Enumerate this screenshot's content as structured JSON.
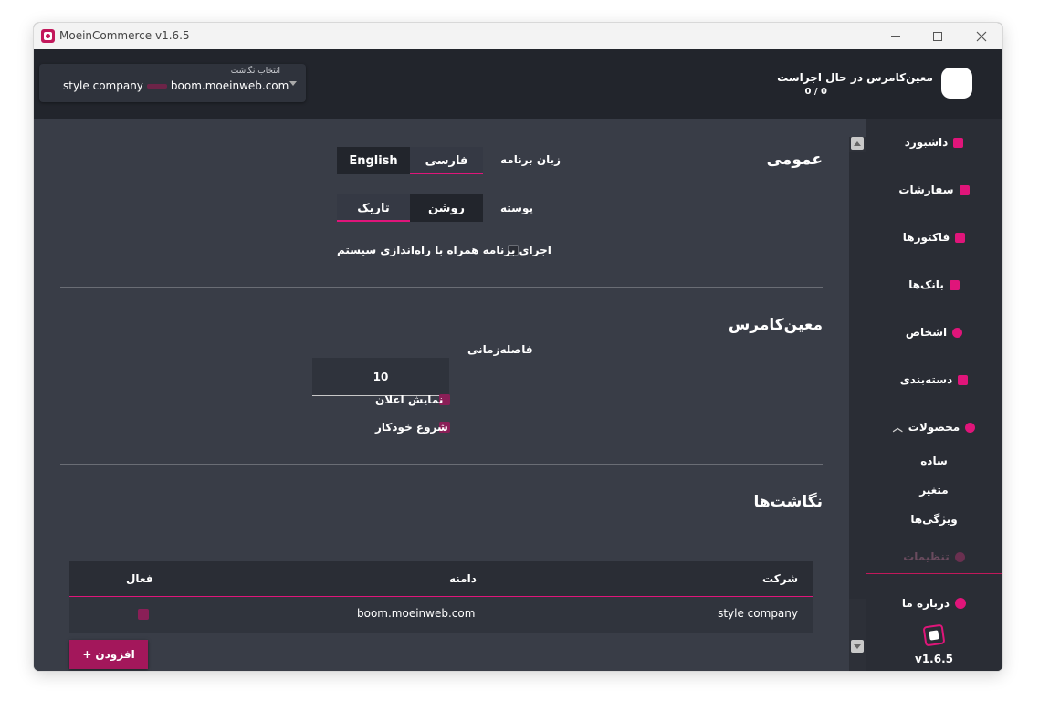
{
  "app": {
    "title": "MoeinCommerce v1.6.5",
    "version": "v1.6.5"
  },
  "header": {
    "blog_select_caption": "انتخاب نگاشت",
    "blog_company": "style company",
    "blog_domain": "boom.moeinweb.com",
    "status_title": "معین‌کامرس در حال اجراست",
    "status_count": "0 / 0"
  },
  "general": {
    "title": "عمومی",
    "language_label": "زبان برنامه",
    "language_options": [
      "فارسی",
      "English"
    ],
    "language_selected": "فارسی",
    "theme_label": "پوسته",
    "theme_options": [
      "روشن",
      "تاریک"
    ],
    "theme_selected": "تاریک",
    "autostart_label": "اجرای برنامه همراه با راه‌اندازی سیستم",
    "autostart_checked": false
  },
  "moein": {
    "title": "معین‌کامرس",
    "interval_label": "فاصله‌زمانی",
    "interval_value": "10",
    "notify_label": "نمایش اعلان",
    "autorun_label": "شروع خودکار"
  },
  "blogs": {
    "title": "نگاشت‌ها",
    "columns": {
      "company": "شرکت",
      "domain": "دامنه",
      "active": "فعال"
    },
    "rows": [
      {
        "company": "style company",
        "domain": "boom.moeinweb.com"
      }
    ],
    "add_label": "افزودن"
  },
  "sidebar": {
    "items": [
      {
        "label": "داشبورد",
        "icon": "dashboard-icon"
      },
      {
        "label": "سفارشات",
        "icon": "orders-icon"
      },
      {
        "label": "فاکتورها",
        "icon": "invoice-icon"
      },
      {
        "label": "بانک‌ها",
        "icon": "bank-icon"
      },
      {
        "label": "اشخاص",
        "icon": "person-icon"
      },
      {
        "label": "دسته‌بندی",
        "icon": "category-icon"
      },
      {
        "label": "محصولات",
        "icon": "product-icon"
      }
    ],
    "product_subitems": [
      "ساده",
      "متغیر",
      "ویژگی‌ها"
    ],
    "settings_label": "تنظیمات",
    "about_label": "درباره ما"
  },
  "colors": {
    "accent": "#e0157a",
    "sidebar_bg": "#2a2d35",
    "main_bg": "#393d47",
    "header_bg": "#22252c"
  }
}
